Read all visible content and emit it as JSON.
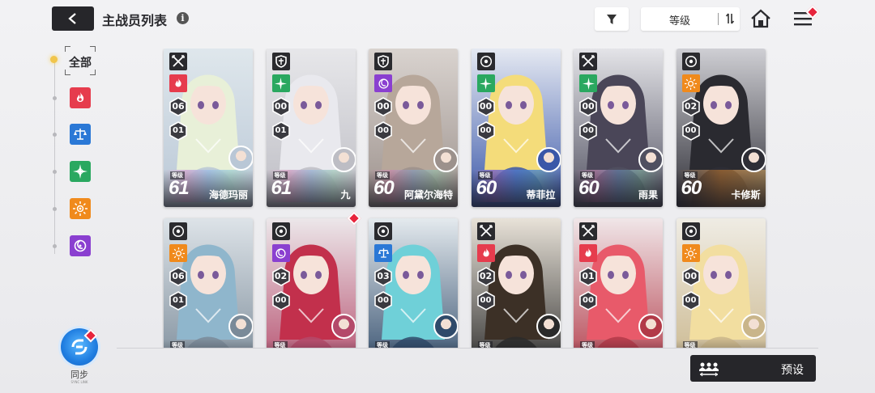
{
  "header": {
    "title": "主战员列表",
    "info_icon": "i",
    "back_icon": "back-arrow-icon",
    "filter_icon": "funnel-icon",
    "sort_label": "等级",
    "sort_dir_icon": "sort-arrows-icon",
    "home_icon": "home-icon",
    "menu_icon": "hamburger-icon"
  },
  "sidebar": {
    "all_label": "全部",
    "elements": [
      {
        "name": "fire",
        "icon": "fire-icon",
        "color": "#e63c4d"
      },
      {
        "name": "order",
        "icon": "scales-icon",
        "color": "#2a78d6"
      },
      {
        "name": "wind",
        "icon": "star-compass-icon",
        "color": "#2aa860"
      },
      {
        "name": "light",
        "icon": "sun-icon",
        "color": "#f08a1c"
      },
      {
        "name": "void",
        "icon": "vortex-icon",
        "color": "#8a3fd0"
      }
    ]
  },
  "sync": {
    "label": "同步",
    "sub": "SYNC LINK"
  },
  "preset": {
    "label": "预设",
    "icon": "team-icon"
  },
  "accent": {
    "alert": "#e8243c",
    "dark": "#26262a"
  },
  "cards": [
    {
      "name": "海德玛丽",
      "level": "61",
      "level_label": "等级",
      "rank": "06",
      "sub": "01",
      "cls": "swords",
      "element": "fire",
      "bg": [
        "#dfe7ec",
        "#b9c7d6"
      ],
      "hair": "#e8f0d8",
      "rainbow": true
    },
    {
      "name": "九",
      "level": "61",
      "level_label": "等级",
      "rank": "00",
      "sub": "01",
      "cls": "shield",
      "element": "wind",
      "bg": [
        "#e7e7ea",
        "#bdbdc4"
      ],
      "hair": "#e9e9ee",
      "rainbow": true
    },
    {
      "name": "阿黛尔海特",
      "level": "60",
      "level_label": "等级",
      "rank": "00",
      "sub": "00",
      "cls": "shield",
      "element": "void",
      "bg": [
        "#d9d3cf",
        "#9c918c"
      ],
      "hair": "#b7a79a",
      "rainbow": true
    },
    {
      "name": "蒂菲拉",
      "level": "60",
      "level_label": "等级",
      "rank": "00",
      "sub": "00",
      "cls": "target",
      "element": "wind",
      "bg": [
        "#e5e9f2",
        "#3a57a8"
      ],
      "hair": "#f4dc7a",
      "rainbow": true
    },
    {
      "name": "雨果",
      "level": "60",
      "level_label": "等级",
      "rank": "00",
      "sub": "00",
      "cls": "swords",
      "element": "wind",
      "bg": [
        "#e4e4e8",
        "#505060"
      ],
      "hair": "#4a4658",
      "rainbow": true
    },
    {
      "name": "卡修斯",
      "level": "60",
      "level_label": "等级",
      "rank": "02",
      "sub": "00",
      "cls": "target",
      "element": "light",
      "bg": [
        "#cfcfd4",
        "#2e2e36"
      ],
      "hair": "#2a2a30",
      "rainbow": false
    },
    {
      "name": "",
      "level": "",
      "level_label": "等级",
      "rank": "06",
      "sub": "01",
      "cls": "target",
      "element": "light",
      "bg": [
        "#dde3e8",
        "#7a8a98"
      ],
      "hair": "#8fb6cc",
      "rainbow": false
    },
    {
      "name": "",
      "level": "",
      "level_label": "等级",
      "rank": "02",
      "sub": "00",
      "cls": "target",
      "element": "void",
      "bg": [
        "#ece7ea",
        "#b44a6a"
      ],
      "hair": "#c2304c",
      "rainbow": false
    },
    {
      "name": "",
      "level": "",
      "level_label": "等级",
      "rank": "03",
      "sub": "00",
      "cls": "target",
      "element": "order",
      "bg": [
        "#e4eaee",
        "#2f4a6a"
      ],
      "hair": "#6fd0d8",
      "rainbow": false
    },
    {
      "name": "",
      "level": "",
      "level_label": "等级",
      "rank": "02",
      "sub": "00",
      "cls": "swords",
      "element": "fire",
      "bg": [
        "#e8e2d8",
        "#2a2a2a"
      ],
      "hair": "#3c3026",
      "rainbow": false
    },
    {
      "name": "",
      "level": "",
      "level_label": "等级",
      "rank": "01",
      "sub": "00",
      "cls": "swords",
      "element": "fire",
      "bg": [
        "#f0e6e8",
        "#b23a48"
      ],
      "hair": "#e85a6a",
      "rainbow": false
    },
    {
      "name": "",
      "level": "",
      "level_label": "等级",
      "rank": "00",
      "sub": "00",
      "cls": "target",
      "element": "light",
      "bg": [
        "#efece4",
        "#c9b58a"
      ],
      "hair": "#f2dea0",
      "rainbow": false
    }
  ]
}
